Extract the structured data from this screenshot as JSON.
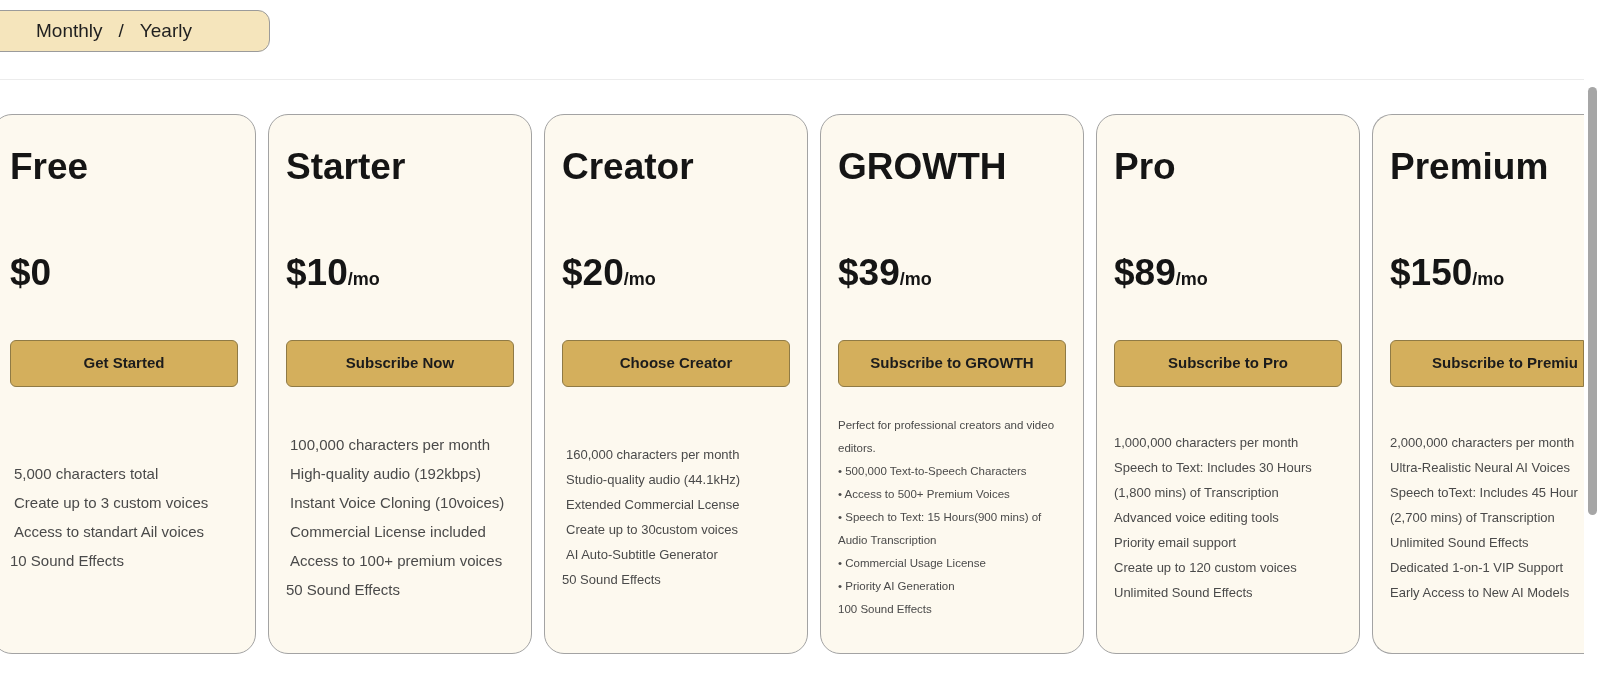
{
  "billing_toggle": {
    "options": [
      {
        "label": "Monthly"
      },
      {
        "label": "Yearly"
      }
    ],
    "separator": "/"
  },
  "plans": [
    {
      "name": "Free",
      "price": "$0",
      "button": "Get Started",
      "features": [
        {
          "text": "5,000 characters total",
          "kind": "indented"
        },
        {
          "text": "Create up to 3 custom voices",
          "kind": "indented"
        },
        {
          "text": "Access to standart Ail voices",
          "kind": "indented"
        },
        {
          "text": "10 Sound Effects",
          "kind": "plain"
        }
      ]
    },
    {
      "name": "Starter",
      "price": "$10",
      "period": "/mo",
      "button": "Subscribe Now",
      "features": [
        {
          "text": "100,000 characters per month",
          "kind": "indented"
        },
        {
          "text": "High-quality audio (192kbps)",
          "kind": "indented"
        },
        {
          "text": "Instant Voice Cloning (10voices)",
          "kind": "indented"
        },
        {
          "text": "Commercial License included",
          "kind": "indented"
        },
        {
          "text": "Access to 100+ premium voices",
          "kind": "indented"
        },
        {
          "text": "50 Sound Effects",
          "kind": "plain"
        }
      ]
    },
    {
      "name": "Creator",
      "price": "$20",
      "period": "/mo",
      "button": "Choose Creator",
      "features": [
        {
          "text": "160,000 characters per month",
          "kind": "indented"
        },
        {
          "text": "Studio-quality audio (44.1kHz)",
          "kind": "indented"
        },
        {
          "text": "Extended Commercial Lcense",
          "kind": "indented"
        },
        {
          "text": "Create up to 30custom voices",
          "kind": "indented"
        },
        {
          "text": "AI Auto-Subtitle Generator",
          "kind": "indented"
        },
        {
          "text": "50 Sound Effects",
          "kind": "plain"
        }
      ]
    },
    {
      "name": "GROWTH",
      "price": "$39",
      "period": "/mo",
      "button": "Subscribe to GROWTH",
      "features": [
        {
          "text": "Perfect for professional creators and video editors.",
          "kind": "plain"
        },
        {
          "text": "• 500,000 Text-to-Speech Characters",
          "kind": "plain"
        },
        {
          "text": "• Access to 500+ Premium Voices",
          "kind": "plain"
        },
        {
          "text": "• Speech to Text: 15 Hours(900 mins) of Audio Transcription",
          "kind": "plain"
        },
        {
          "text": "• Commercial Usage License",
          "kind": "plain"
        },
        {
          "text": "• Priority AI Generation",
          "kind": "plain"
        },
        {
          "text": "100 Sound Effects",
          "kind": "plain"
        }
      ]
    },
    {
      "name": "Pro",
      "price": "$89",
      "period": "/mo",
      "button": "Subscribe to Pro",
      "features": [
        {
          "text": "1,000,000 characters per month",
          "kind": "plain"
        },
        {
          "text": "Speech to Text: Includes 30 Hours",
          "kind": "plain"
        },
        {
          "text": "(1,800 mins) of Transcription",
          "kind": "plain"
        },
        {
          "text": "Advanced voice editing tools",
          "kind": "plain"
        },
        {
          "text": "Priority email support",
          "kind": "plain"
        },
        {
          "text": "Create up to 120 custom voices",
          "kind": "plain"
        },
        {
          "text": "Unlimited Sound Effects",
          "kind": "plain"
        }
      ]
    },
    {
      "name": "Premium",
      "price": "$150",
      "period": "/mo",
      "button": "Subscribe to Premiu",
      "features": [
        {
          "text": "2,000,000 characters per month",
          "kind": "plain"
        },
        {
          "text": "Ultra-Realistic Neural AI Voices",
          "kind": "plain"
        },
        {
          "text": "Speech toText: Includes 45 Hour",
          "kind": "plain"
        },
        {
          "text": "(2,700 mins) of Transcription",
          "kind": "plain"
        },
        {
          "text": "Unlimited Sound Effects",
          "kind": "plain"
        },
        {
          "text": "Dedicated 1-on-1 VIP Support",
          "kind": "plain"
        },
        {
          "text": "Early Access to New AI Models",
          "kind": "plain"
        }
      ]
    }
  ]
}
